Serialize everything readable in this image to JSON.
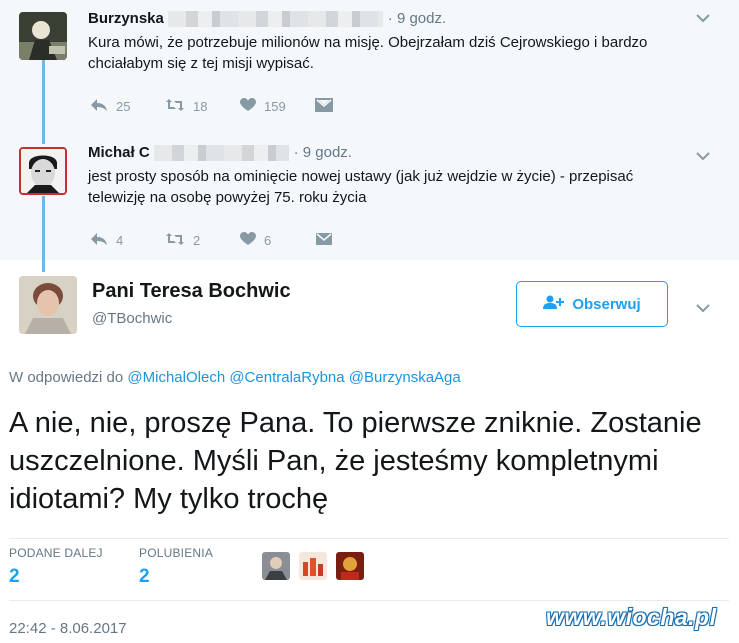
{
  "reply1": {
    "name": "Burzynska",
    "time": "· 9 godz.",
    "text": "Kura mówi, że potrzebuje milionów na misję. Obejrzałam dziś Cejrowskiego i bardzo chciałabym się z tej misji wypisać.",
    "replies": "25",
    "retweets": "18",
    "likes": "159"
  },
  "reply2": {
    "name": "Michał C",
    "time": "· 9 godz.",
    "text": "jest prosty sposób na ominięcie nowej ustawy (jak już wejdzie w życie) - przepisać telewizję na osobę powyżej 75. roku życia",
    "replies": "4",
    "retweets": "2",
    "likes": "6"
  },
  "main": {
    "name": "Pani Teresa Bochwic",
    "handle": "@TBochwic",
    "follow_label": "Obserwuj",
    "reply_prefix": "W odpowiedzi do",
    "reply_to": "@MichalOlech @CentralaRybna @BurzynskaAga",
    "text": "A nie, nie, proszę Pana. To pierwsze zniknie. Zostanie uszczelnione. Myśli Pan, że jesteśmy kompletnymi idiotami? My tylko trochę",
    "retweets_label": "PODANE DALEJ",
    "retweets_value": "2",
    "likes_label": "POLUBIENIA",
    "likes_value": "2",
    "timestamp": "22:42 - 8.06.2017"
  },
  "watermark": "www.wiocha.pl",
  "colors": {
    "accent": "#1da1f2",
    "muted": "#657786",
    "thread": "#6fb8df",
    "bg_context": "#f5f8fa"
  },
  "icons": [
    "reply-icon",
    "retweet-icon",
    "heart-icon",
    "dm-icon",
    "chevron-down-icon",
    "follow-user-icon"
  ]
}
